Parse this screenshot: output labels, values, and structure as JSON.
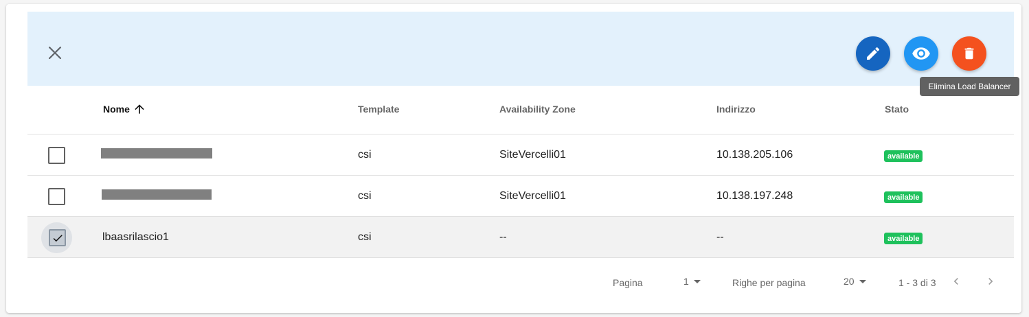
{
  "toolbar": {
    "actions": {
      "edit_color": "#1565c0",
      "view_color": "#2196f3",
      "delete_color": "#f4511e"
    },
    "tooltip": "Elimina Load Balancer"
  },
  "table": {
    "columns": [
      "Nome",
      "Template",
      "Availability Zone",
      "Indirizzo",
      "Stato"
    ],
    "sort": {
      "column": "Nome",
      "direction": "asc"
    },
    "rows": [
      {
        "selected": false,
        "name": "",
        "name_redacted": true,
        "template": "csi",
        "zone": "SiteVercelli01",
        "address": "10.138.205.106",
        "status": "available"
      },
      {
        "selected": false,
        "name": "",
        "name_redacted": true,
        "template": "csi",
        "zone": "SiteVercelli01",
        "address": "10.138.197.248",
        "status": "available"
      },
      {
        "selected": true,
        "name": "lbaasrilascio1",
        "name_redacted": false,
        "template": "csi",
        "zone": "--",
        "address": "--",
        "status": "available"
      }
    ],
    "status_color": "#1ec15c"
  },
  "pagination": {
    "page_label": "Pagina",
    "page_value": "1",
    "rows_label": "Righe per pagina",
    "rows_value": "20",
    "range": "1 - 3 di 3"
  }
}
